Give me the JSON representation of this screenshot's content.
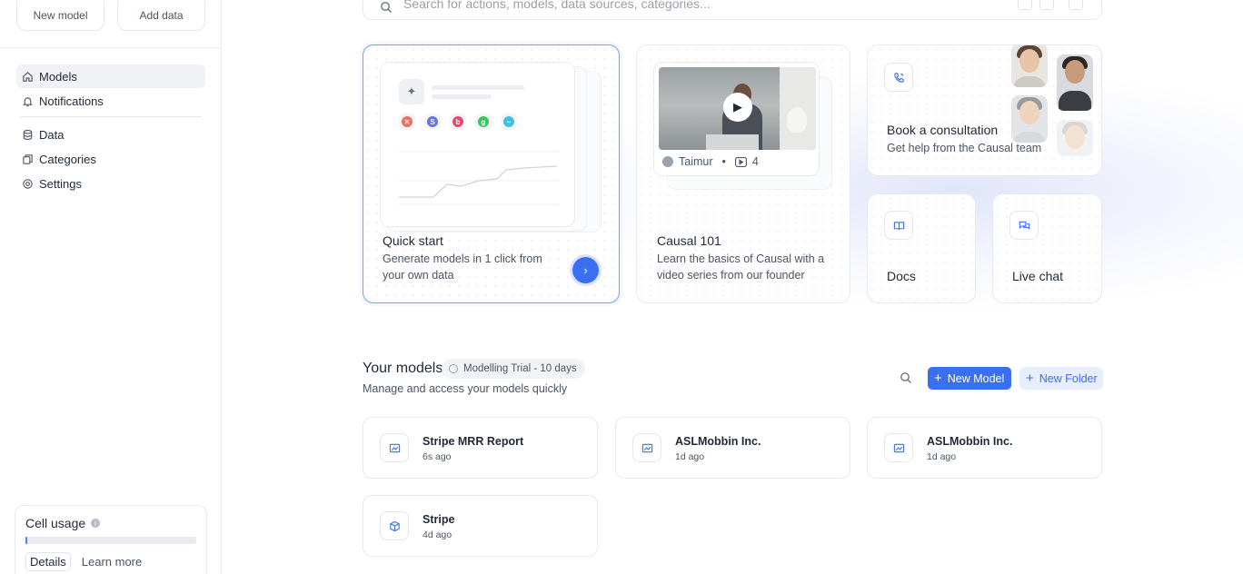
{
  "sidebar": {
    "top_buttons": {
      "new_model": "New model",
      "add_data": "Add data"
    },
    "nav": [
      {
        "label": "Models",
        "icon": "home-icon",
        "active": true
      },
      {
        "label": "Notifications",
        "icon": "bell-icon"
      },
      {
        "label": "Data",
        "icon": "database-icon"
      },
      {
        "label": "Categories",
        "icon": "categories-icon"
      },
      {
        "label": "Settings",
        "icon": "gear-icon"
      }
    ],
    "usage": {
      "title": "Cell usage",
      "fill": 0.01,
      "details": "Details",
      "learn_more": "Learn more"
    }
  },
  "search": {
    "placeholder": "Search for actions, models, data sources, categories..."
  },
  "cards": {
    "quick_start": {
      "title": "Quick start",
      "desc": "Generate models in 1 click from your own data"
    },
    "causal101": {
      "title": "Causal 101",
      "desc": "Learn the basics of Causal with a video series from our founder",
      "presenter": "Taimur",
      "video_count": "4"
    },
    "consult": {
      "title": "Book a consultation",
      "desc": "Get help from the Causal team"
    },
    "docs": {
      "title": "Docs"
    },
    "chat": {
      "title": "Live chat"
    }
  },
  "models": {
    "title": "Your models",
    "trial": "Modelling Trial - 10 days",
    "subtitle": "Manage and access your models quickly",
    "new_model": "New Model",
    "new_folder": "New Folder",
    "items": [
      {
        "name": "Stripe MRR Report",
        "time": "6s ago",
        "icon": "chart-icon"
      },
      {
        "name": "ASLMobbin Inc.",
        "time": "1d ago",
        "icon": "chart-icon"
      },
      {
        "name": "ASLMobbin Inc.",
        "time": "1d ago",
        "icon": "chart-icon"
      },
      {
        "name": "Stripe",
        "time": "4d ago",
        "icon": "cube-icon"
      }
    ]
  },
  "colors": {
    "accent": "#3a6ff2",
    "accent_light": "#e8eefd",
    "border": "#e7e9ee"
  }
}
